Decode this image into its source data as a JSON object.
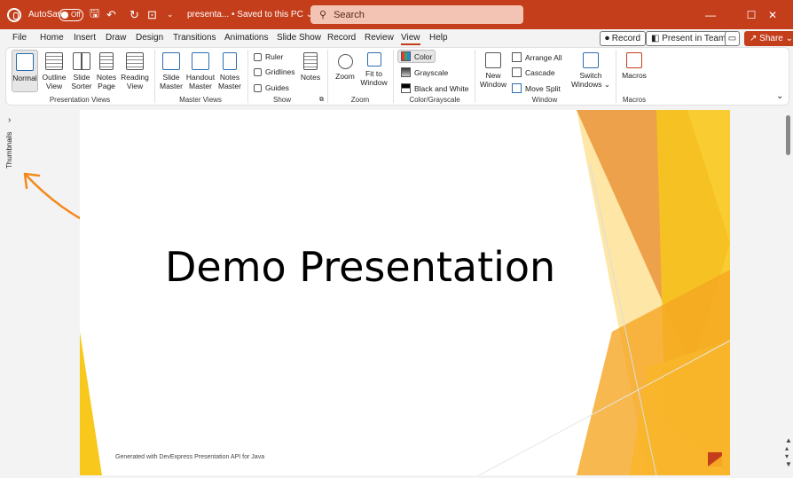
{
  "titlebar": {
    "autosave_label": "AutoSave",
    "autosave_state": "Off",
    "doc_title": "presenta...  •  Saved to this PC",
    "search_placeholder": "Search",
    "minimize": "—",
    "maximize": "☐",
    "close": "✕"
  },
  "tabs": [
    "File",
    "Home",
    "Insert",
    "Draw",
    "Design",
    "Transitions",
    "Animations",
    "Slide Show",
    "Record",
    "Review",
    "View",
    "Help"
  ],
  "active_tab": "View",
  "right_buttons": {
    "record": "Record",
    "present": "Present in Teams",
    "share": "Share"
  },
  "ribbon": {
    "presentation_views": {
      "label": "Presentation Views",
      "normal": "Normal",
      "outline_1": "Outline",
      "outline_2": "View",
      "sorter_1": "Slide",
      "sorter_2": "Sorter",
      "notes_1": "Notes",
      "notes_2": "Page",
      "reading_1": "Reading",
      "reading_2": "View"
    },
    "master_views": {
      "label": "Master Views",
      "slide_1": "Slide",
      "slide_2": "Master",
      "handout_1": "Handout",
      "handout_2": "Master",
      "notes_1": "Notes",
      "notes_2": "Master"
    },
    "show": {
      "label": "Show",
      "ruler": "Ruler",
      "gridlines": "Gridlines",
      "guides": "Guides",
      "notes": "Notes"
    },
    "zoom": {
      "label": "Zoom",
      "zoom": "Zoom",
      "fit_1": "Fit to",
      "fit_2": "Window"
    },
    "color": {
      "label": "Color/Grayscale",
      "color": "Color",
      "grayscale": "Grayscale",
      "bw": "Black and White"
    },
    "window": {
      "label": "Window",
      "new_1": "New",
      "new_2": "Window",
      "arrange": "Arrange All",
      "cascade": "Cascade",
      "split": "Move Split",
      "switch_1": "Switch",
      "switch_2": "Windows ⌄"
    },
    "macros": {
      "label": "Macros",
      "macros": "Macros"
    }
  },
  "thumbnails_label": "Thumbnails",
  "slide": {
    "title": "Demo Presentation",
    "footer": "Generated with DevExpress Presentation API for Java"
  },
  "colors": {
    "accent": "#c43e1c",
    "slide_orange": "#f5a623",
    "slide_yellow": "#f8c81c"
  }
}
